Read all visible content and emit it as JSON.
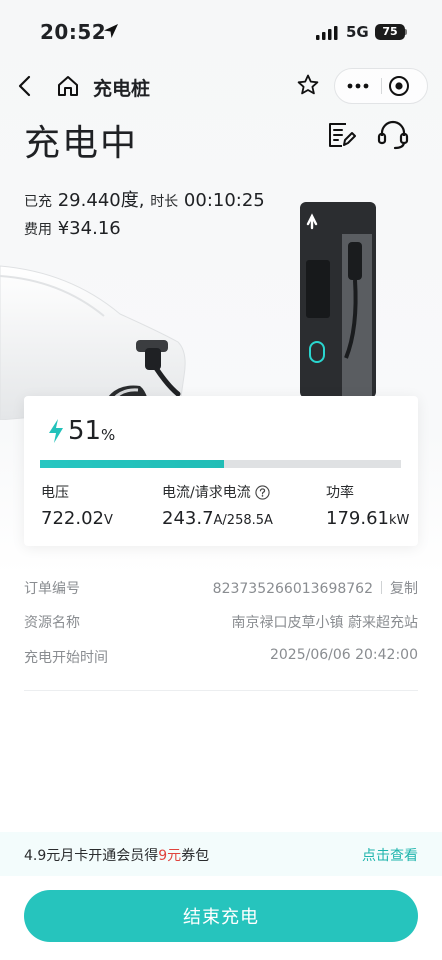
{
  "status_bar": {
    "time": "20:52",
    "network": "5G",
    "battery": "75"
  },
  "nav": {
    "title": "充电桩"
  },
  "page_title": "充电中",
  "summary": {
    "charged_label": "已充",
    "charged_value": "29.440度,",
    "duration_label": "时长",
    "duration_value": "00:10:25",
    "fee_label": "费用",
    "fee_value": "¥34.16"
  },
  "battery_card": {
    "percent": "51",
    "percent_sign": "%",
    "progress": 0.51,
    "voltage": {
      "label": "电压",
      "value": "722.02",
      "unit": "V"
    },
    "current": {
      "label": "电流/请求电流",
      "value": "243.7",
      "unit": "A/258.5A"
    },
    "power": {
      "label": "功率",
      "value": "179.61",
      "unit": "kW"
    }
  },
  "order_info": {
    "order_no_label": "订单编号",
    "order_no_value": "823735266013698762",
    "copy_label": "复制",
    "station_label": "资源名称",
    "station_value": "南京禄口皮草小镇 蔚来超充站",
    "start_label": "充电开始时间",
    "start_value": "2025/06/06 20:42:00"
  },
  "promo": {
    "text_before": "4.9元月卡开通会员得",
    "highlight": "9元",
    "text_after": "券包",
    "link": "点击查看"
  },
  "end_button": "结束充电",
  "colors": {
    "accent": "#26c4bd",
    "highlight": "#e0443e",
    "muted": "#8a8d91"
  }
}
